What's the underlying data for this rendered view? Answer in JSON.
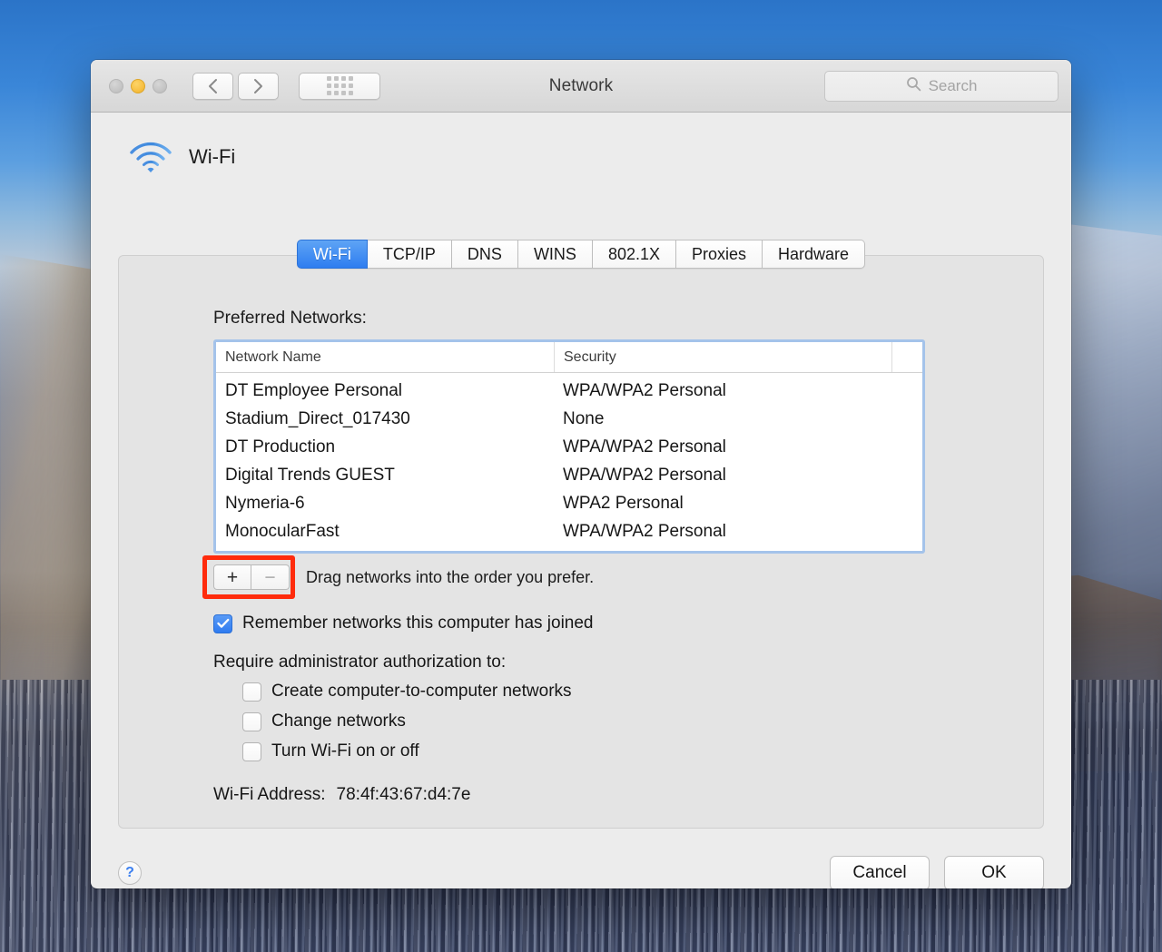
{
  "window": {
    "title": "Network",
    "traffic_lights": [
      {
        "name": "close",
        "color": "#c2c2c2"
      },
      {
        "name": "minimize",
        "color": "#f7c043"
      },
      {
        "name": "zoom",
        "color": "#c2c2c2"
      }
    ],
    "nav": {
      "back_icon": "chevron-left-icon",
      "forward_icon": "chevron-right-icon",
      "grid_icon": "show-all-grid-icon"
    },
    "search": {
      "placeholder": "Search",
      "value": "",
      "icon": "search-icon"
    }
  },
  "service": {
    "icon": "wifi-icon",
    "name": "Wi-Fi"
  },
  "tabs": [
    {
      "label": "Wi-Fi",
      "active": true
    },
    {
      "label": "TCP/IP",
      "active": false
    },
    {
      "label": "DNS",
      "active": false
    },
    {
      "label": "WINS",
      "active": false
    },
    {
      "label": "802.1X",
      "active": false
    },
    {
      "label": "Proxies",
      "active": false
    },
    {
      "label": "Hardware",
      "active": false
    }
  ],
  "preferred_networks": {
    "label": "Preferred Networks:",
    "columns": [
      "Network Name",
      "Security",
      ""
    ],
    "rows": [
      {
        "name": "DT Employee Personal",
        "security": "WPA/WPA2 Personal"
      },
      {
        "name": "Stadium_Direct_017430",
        "security": "None"
      },
      {
        "name": "DT Production",
        "security": "WPA/WPA2 Personal"
      },
      {
        "name": "Digital Trends GUEST",
        "security": "WPA/WPA2 Personal"
      },
      {
        "name": "Nymeria-6",
        "security": "WPA2 Personal"
      },
      {
        "name": "MonocularFast",
        "security": "WPA/WPA2 Personal"
      }
    ]
  },
  "list_controls": {
    "add_label": "+",
    "remove_label": "−",
    "hint": "Drag networks into the order you prefer.",
    "highlight_color": "#ff2b0c"
  },
  "options": {
    "remember": {
      "label": "Remember networks this computer has joined",
      "checked": true
    },
    "require_label": "Require administrator authorization to:",
    "require_items": [
      {
        "label": "Create computer-to-computer networks",
        "checked": false
      },
      {
        "label": "Change networks",
        "checked": false
      },
      {
        "label": "Turn Wi-Fi on or off",
        "checked": false
      }
    ]
  },
  "wifi_address": {
    "label": "Wi-Fi Address:",
    "value": "78:4f:43:67:d4:7e"
  },
  "footer": {
    "help_label": "?",
    "cancel_label": "Cancel",
    "ok_label": "OK"
  },
  "theme": {
    "accent_blue": "#2e7df0",
    "window_bg": "#ececec",
    "panel_bg": "#e4e4e4",
    "focus_ring": "#a4c3ea"
  }
}
